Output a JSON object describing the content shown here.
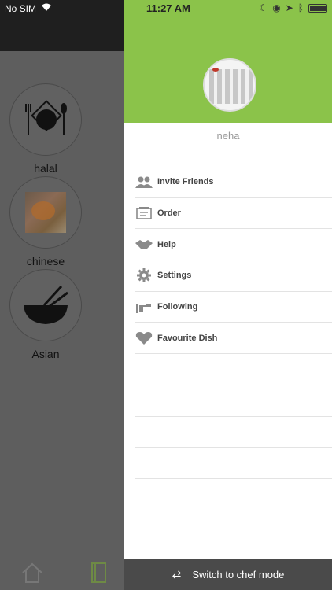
{
  "status": {
    "carrier": "No SIM",
    "time": "11:27 AM"
  },
  "categories": [
    {
      "label": "halal",
      "icon": "plate-fork-spoon-icon"
    },
    {
      "label": "chinese",
      "icon": "noodles-photo"
    },
    {
      "label": "Asian",
      "icon": "bowl-chopsticks-icon"
    }
  ],
  "drawer": {
    "user_name": "neha",
    "menu": [
      {
        "label": "Invite Friends",
        "icon": "people-icon"
      },
      {
        "label": "Order",
        "icon": "order-icon"
      },
      {
        "label": "Help",
        "icon": "handshake-icon"
      },
      {
        "label": "Settings",
        "icon": "gear-icon"
      },
      {
        "label": "Following",
        "icon": "following-icon"
      },
      {
        "label": "Favourite Dish",
        "icon": "heart-icon"
      }
    ],
    "switch_label": "Switch to chef mode"
  },
  "colors": {
    "header_green": "#8bc34a",
    "footer_dark": "#4a4a4a"
  }
}
